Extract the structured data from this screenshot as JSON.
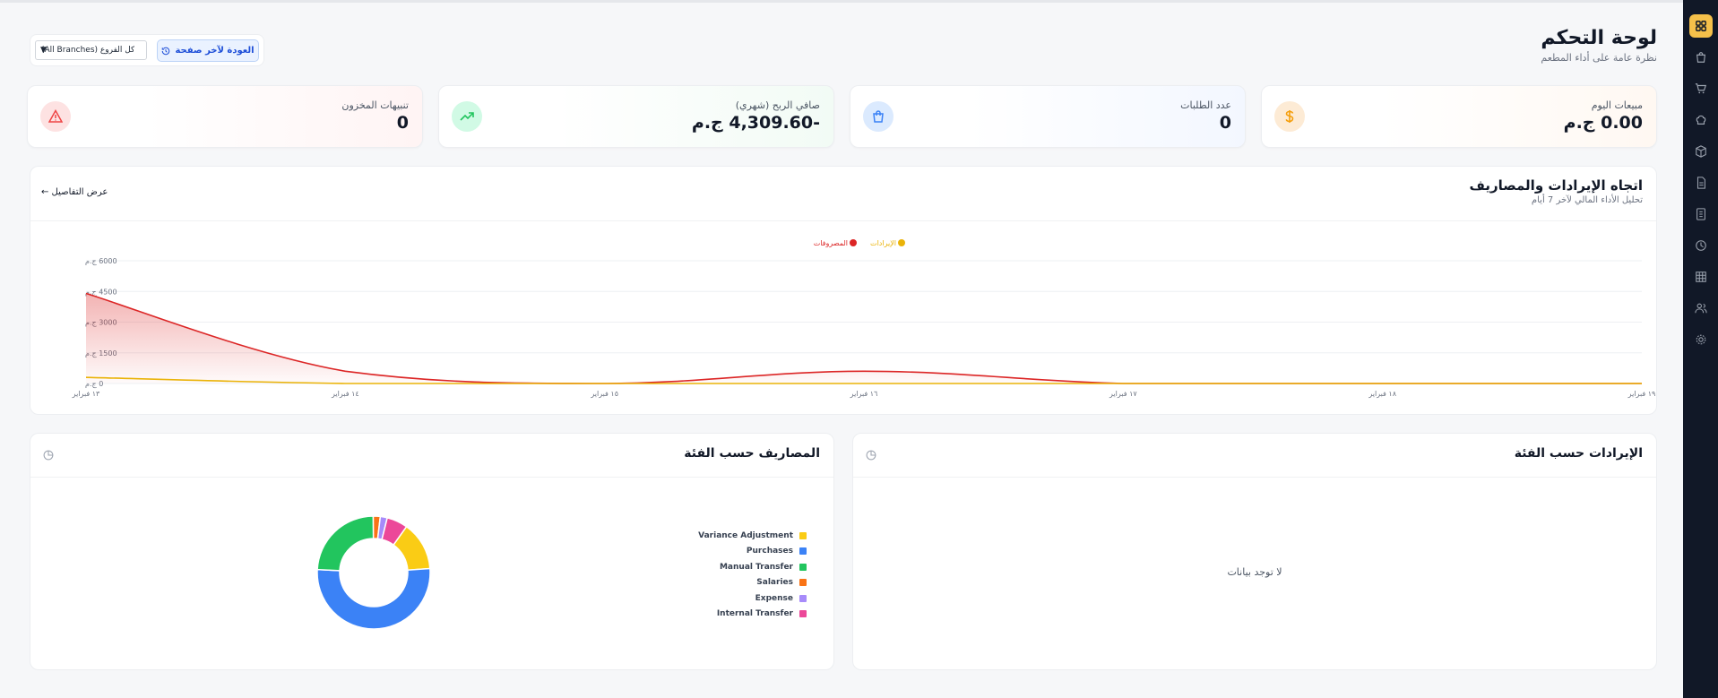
{
  "header": {
    "title": "لوحة التحكم",
    "subtitle": "نظرة عامة على أداء المطعم"
  },
  "controls": {
    "branch_value": "كل الفروع (All Branches)",
    "back_label": "العودة لآخر صفحة"
  },
  "stats": [
    {
      "label": "مبيعات اليوم",
      "value": "0.00 ج.م",
      "icon": "dollar-icon",
      "color": "#f59e0b"
    },
    {
      "label": "عدد الطلبات",
      "value": "0",
      "icon": "shopping-bag-icon",
      "color": "#3b82f6"
    },
    {
      "label": "صافي الربح (شهري)",
      "value": "-4,309.60 ج.م",
      "icon": "trending-up-icon",
      "color": "#22c55e"
    },
    {
      "label": "تنبيهات المخزون",
      "value": "0",
      "icon": "alert-triangle-icon",
      "color": "#ef4444"
    }
  ],
  "trend": {
    "title": "اتجاه الإيرادات والمصاريف",
    "subtitle": "تحليل الأداء المالي لآخر 7 أيام",
    "details_label": "عرض التفاصيل ←"
  },
  "revenue_card": {
    "title": "الإيرادات حسب الفئة",
    "empty": "لا توجد بيانات"
  },
  "expense_card": {
    "title": "المصاريف حسب الفئة"
  },
  "colors": {
    "revenue": "#eab308",
    "expense": "#dc2626",
    "accent": "#f5c04a"
  },
  "chart_data": [
    {
      "type": "area",
      "categories": [
        "١٣ فبراير",
        "١٤ فبراير",
        "١٥ فبراير",
        "١٦ فبراير",
        "١٧ فبراير",
        "١٨ فبراير",
        "١٩ فبراير"
      ],
      "series": [
        {
          "name": "الإيرادات",
          "color": "#eab308",
          "values": [
            300,
            0,
            0,
            0,
            0,
            0,
            0
          ]
        },
        {
          "name": "المصروفات",
          "color": "#dc2626",
          "values": [
            4400,
            600,
            0,
            600,
            0,
            0,
            0
          ]
        }
      ],
      "ylim": [
        0,
        6000
      ],
      "yticks": [
        "0 ج.م",
        "1500 ج.م",
        "3000 ج.م",
        "4500 ج.م",
        "6000 ج.م"
      ],
      "ytick_values": [
        0,
        1500,
        3000,
        4500,
        6000
      ],
      "legend": "top-center",
      "grid": true
    },
    {
      "type": "pie",
      "donut": true,
      "categories": [
        "Variance Adjustment",
        "Purchases",
        "Manual Transfer",
        "Salaries",
        "Expense",
        "Internal Transfer"
      ],
      "colors": [
        "#facc15",
        "#3b82f6",
        "#22c55e",
        "#f97316",
        "#a78bfa",
        "#ec4899"
      ],
      "values": [
        14,
        52,
        24,
        2,
        2,
        6
      ],
      "legend": "right"
    }
  ]
}
